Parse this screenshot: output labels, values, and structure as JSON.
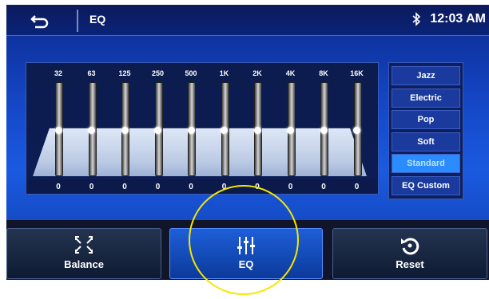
{
  "header": {
    "title": "EQ",
    "time": "12:03 AM"
  },
  "eq": {
    "bands": [
      "32",
      "63",
      "125",
      "250",
      "500",
      "1K",
      "2K",
      "4K",
      "8K",
      "16K"
    ],
    "values": [
      "0",
      "0",
      "0",
      "0",
      "0",
      "0",
      "0",
      "0",
      "0",
      "0"
    ]
  },
  "presets": [
    "Jazz",
    "Electric",
    "Pop",
    "Soft",
    "Standard",
    "EQ Custom"
  ],
  "active_preset": "Standard",
  "bottom": {
    "balance": "Balance",
    "eq": "EQ",
    "reset": "Reset"
  },
  "colors": {
    "accent": "#2a8cff",
    "annotation": "#f5e700"
  },
  "icons": {
    "back": "back-arrow-icon",
    "bluetooth": "bluetooth-icon",
    "balance": "balance-icon",
    "eq": "eq-sliders-icon",
    "reset": "reset-icon"
  }
}
